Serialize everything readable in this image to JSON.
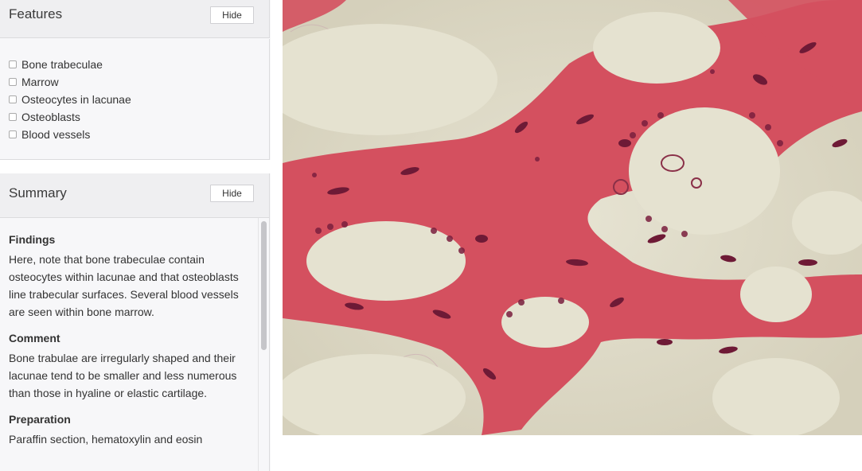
{
  "features": {
    "title": "Features",
    "hide_label": "Hide",
    "items": [
      {
        "label": "Bone trabeculae"
      },
      {
        "label": "Marrow"
      },
      {
        "label": "Osteocytes in lacunae"
      },
      {
        "label": "Osteoblasts"
      },
      {
        "label": "Blood vessels"
      }
    ]
  },
  "summary": {
    "title": "Summary",
    "hide_label": "Hide",
    "sections": [
      {
        "heading": "Findings",
        "text": "Here, note that bone trabeculae contain osteocytes within lacunae and that osteoblasts line trabecular surfaces. Several blood vessels are seen within bone marrow."
      },
      {
        "heading": "Comment",
        "text": "Bone trabulae are irregularly shaped and their lacunae tend to be smaller and less numerous than those in hyaline or elastic cartilage."
      },
      {
        "heading": "Preparation",
        "text": "Paraffin section, hematoxylin and eosin"
      }
    ]
  },
  "colors": {
    "bone": "#d4505f",
    "marrow": "#dbd7c4",
    "nuclei": "#6e1a36",
    "header_bg": "#efeff1",
    "panel_bg": "#f7f7f9"
  }
}
